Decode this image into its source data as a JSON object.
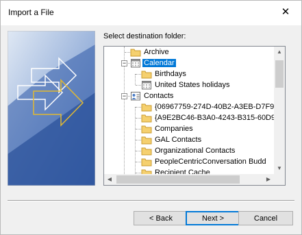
{
  "window": {
    "title": "Import a File",
    "close_glyph": "✕"
  },
  "dialog": {
    "dest_label": "Select destination folder:"
  },
  "tree": {
    "items": [
      {
        "label": "Archive",
        "icon": "folder-icon"
      },
      {
        "label": "Calendar",
        "icon": "calendar-icon",
        "selected": true,
        "expander": "−"
      },
      {
        "label": "Birthdays",
        "icon": "folder-icon"
      },
      {
        "label": "United States holidays",
        "icon": "calendar-icon"
      },
      {
        "label": "Contacts",
        "icon": "contacts-icon",
        "expander": "−"
      },
      {
        "label": "{06967759-274D-40B2-A3EB-D7F9",
        "icon": "folder-icon"
      },
      {
        "label": "{A9E2BC46-B3A0-4243-B315-60D9",
        "icon": "folder-icon"
      },
      {
        "label": "Companies",
        "icon": "folder-icon"
      },
      {
        "label": "GAL Contacts",
        "icon": "folder-icon"
      },
      {
        "label": "Organizational Contacts",
        "icon": "folder-icon"
      },
      {
        "label": "PeopleCentricConversation Budd",
        "icon": "folder-icon"
      },
      {
        "label": "Recipient Cache",
        "icon": "folder-icon"
      }
    ]
  },
  "scrollbar": {
    "up": "▲",
    "down": "▼",
    "left": "◀",
    "right": "▶"
  },
  "buttons": {
    "back": "< Back",
    "next": "Next >",
    "cancel": "Cancel"
  },
  "colors": {
    "selection": "#0078d7",
    "folder": "#f5d06f"
  }
}
